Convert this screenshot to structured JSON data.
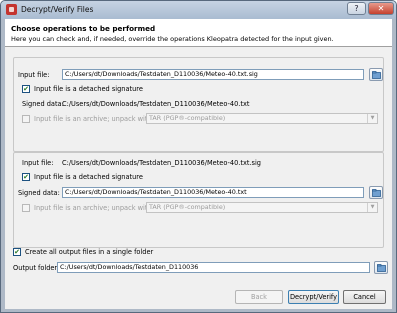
{
  "window": {
    "title": "Decrypt/Verify Files",
    "help_label": "?",
    "close_label": "✕"
  },
  "header": {
    "title": "Choose operations to be performed",
    "description": "Here you can check and, if needed, override the operations Kleopatra detected for the input given."
  },
  "group1": {
    "input_file_label": "Input file:",
    "input_file_value": "C:/Users/dt/Downloads/Testdaten_D110036/Meteo-40.txt.sig",
    "detached_checkbox_label": "Input file is a detached signature",
    "signed_data_label": "Signed data:",
    "signed_data_value": "C:/Users/dt/Downloads/Testdaten_D110036/Meteo-40.txt",
    "archive_checkbox_label": "Input file is an archive; unpack with:",
    "archive_format": "TAR (PGP®-compatible)"
  },
  "group2": {
    "input_file_label": "Input file:",
    "input_file_value": "C:/Users/dt/Downloads/Testdaten_D110036/Meteo-40.txt.sig",
    "detached_checkbox_label": "Input file is a detached signature",
    "signed_data_label": "Signed data:",
    "signed_data_value": "C:/Users/dt/Downloads/Testdaten_D110036/Meteo-40.txt",
    "archive_checkbox_label": "Input file is an archive; unpack with:",
    "archive_format": "TAR (PGP®-compatible)"
  },
  "output": {
    "single_folder_label": "Create all output files in a single folder",
    "folder_label": "Output folder:",
    "folder_value": "C:/Users/dt/Downloads/Testdaten_D110036"
  },
  "buttons": {
    "back": "Back",
    "decrypt_verify": "Decrypt/Verify",
    "cancel": "Cancel"
  }
}
